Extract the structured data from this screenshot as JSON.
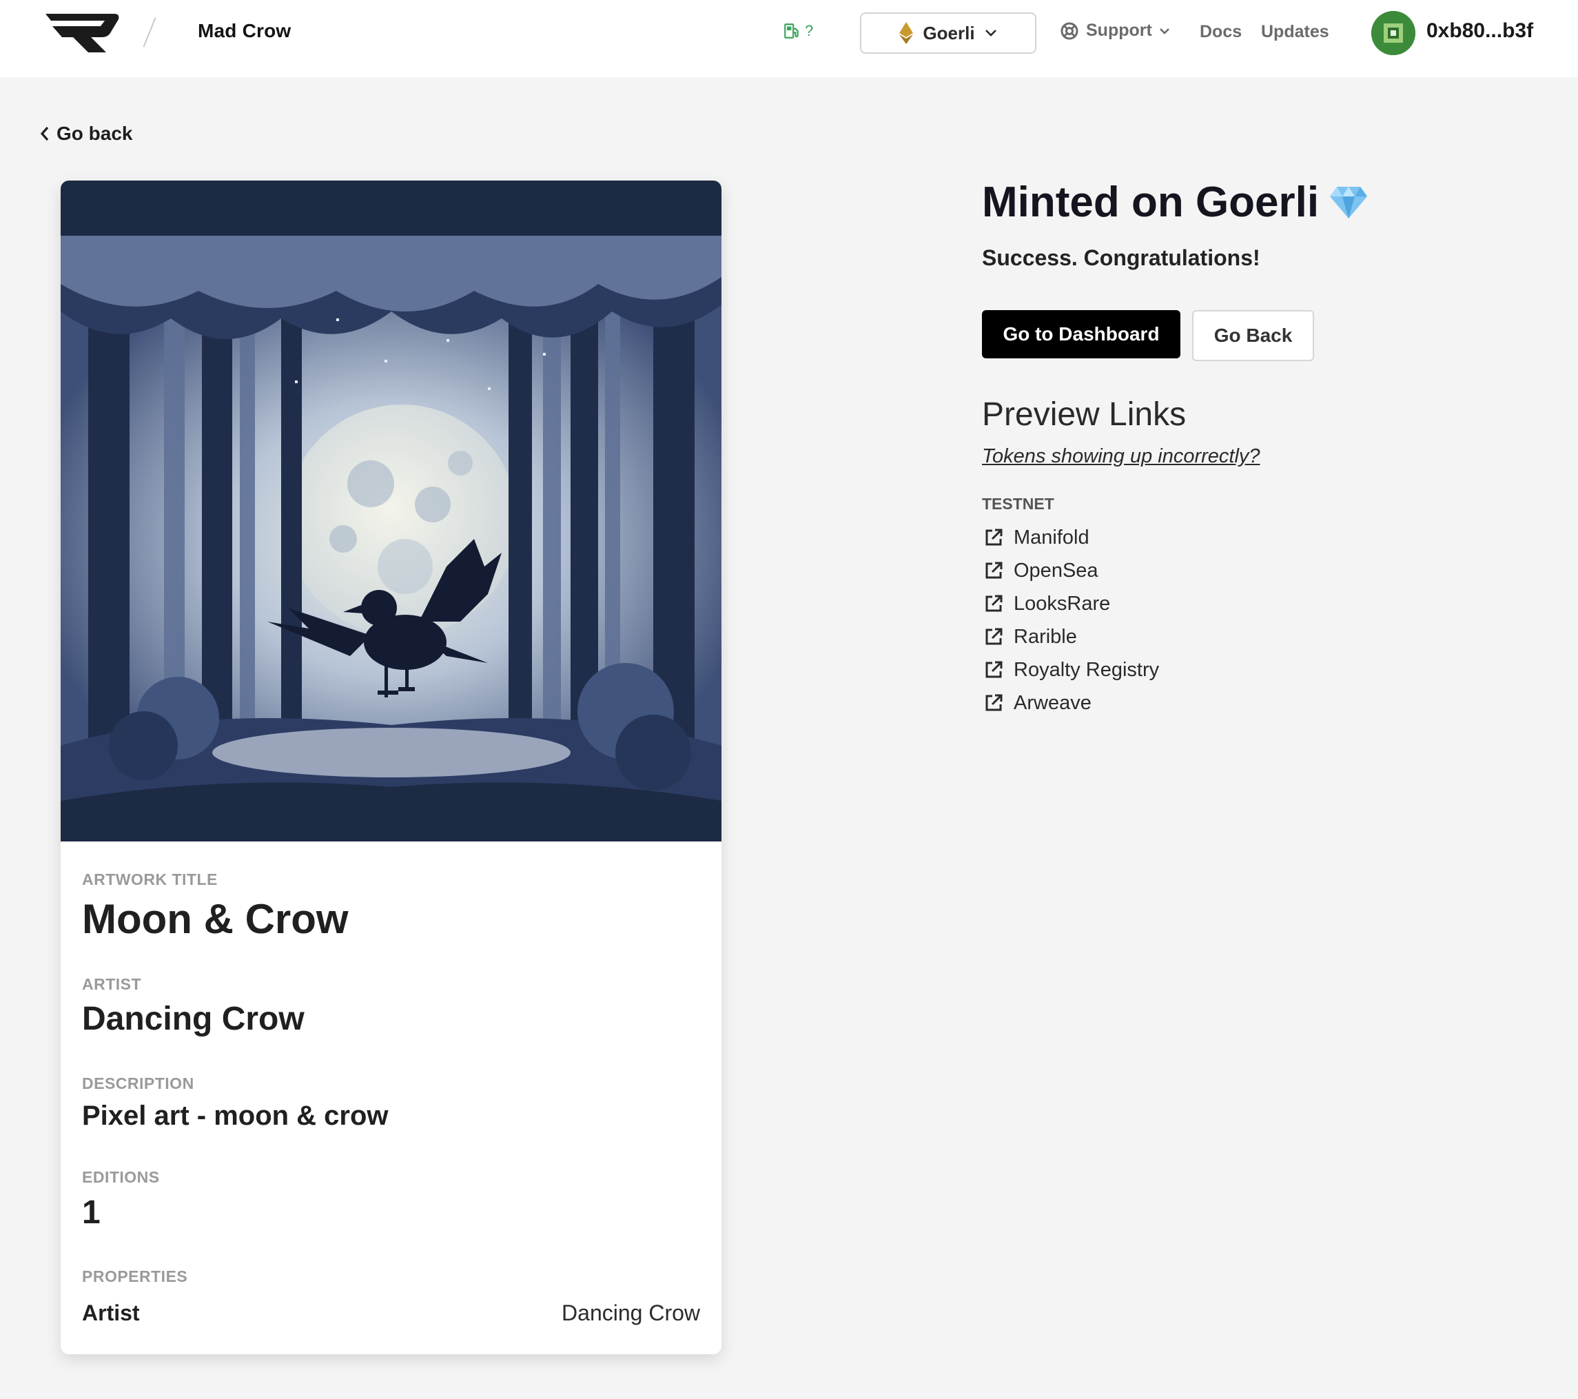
{
  "header": {
    "project_name": "Mad Crow",
    "gas_label": "?",
    "network": "Goerli",
    "support_label": "Support",
    "docs_label": "Docs",
    "updates_label": "Updates",
    "wallet_address": "0xb80...b3f"
  },
  "back_link": "Go back",
  "card": {
    "artwork_title_label": "ARTWORK TITLE",
    "artwork_title": "Moon & Crow",
    "artist_label": "ARTIST",
    "artist": "Dancing Crow",
    "description_label": "DESCRIPTION",
    "description": "Pixel art - moon & crow",
    "editions_label": "EDITIONS",
    "editions": "1",
    "properties_label": "PROPERTIES",
    "properties": [
      {
        "key": "Artist",
        "value": "Dancing Crow"
      }
    ]
  },
  "result": {
    "title": "Minted on Goerli",
    "subtitle": "Success. Congratulations!",
    "dashboard_button": "Go to Dashboard",
    "go_back_button": "Go Back"
  },
  "preview": {
    "heading": "Preview Links",
    "incorrect_link": "Tokens showing up incorrectly?",
    "section_label": "TESTNET",
    "links": [
      "Manifold",
      "OpenSea",
      "LooksRare",
      "Rarible",
      "Royalty Registry",
      "Arweave"
    ]
  },
  "colors": {
    "accent_black": "#000000",
    "gas_green": "#3aa35b",
    "background": "#f4f4f4",
    "eth_gold": "#c99a2e"
  },
  "icons": [
    "manifold-logo-icon",
    "gas-pump-icon",
    "ethereum-icon",
    "chevron-down-icon",
    "lifebuoy-icon",
    "chevron-left-icon",
    "diamond-icon",
    "external-link-icon"
  ]
}
